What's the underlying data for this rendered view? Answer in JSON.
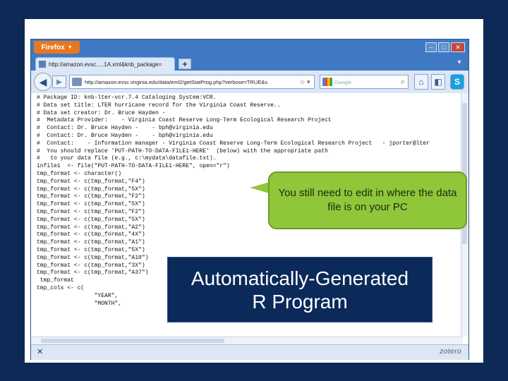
{
  "browser": {
    "app_button": "Firefox",
    "tab_title": "http://amazon.evsc.....1A.xml&knb_package=",
    "new_tab": "+",
    "url": "http://amazon.evsc.virginia.edu/data/eml2/getStatProg.php?verbose=TRUE&s",
    "search_placeholder": "Google",
    "status_right": "zotero"
  },
  "code_lines": [
    "# Package ID: knb-lter-vcr.7.4 Cataloging System:VCR.",
    "# Data set title: LTER hurricane record for the Virginia Coast Reserve..",
    "# Data set creator: Dr. Bruce Hayden -",
    "#  Metadata Provider:    - Virginia Coast Reserve Long-Term Ecological Research Project",
    "#  Contact: Dr. Bruce Hayden -    - bph@virginia.edu",
    "#  Contact: Dr. Bruce Hayden -    - bph@virginia.edu",
    "#  Contact:    - Information manager - Virginia Coast Reserve Long-Term Ecological Research Project   - jporter@lter",
    "#  You should replace 'PUT-PATH-TO-DATA-FILE1-HERE'  (below) with the appropriate path",
    "#   to your data file (e.g., c:\\mydata\\datafile.txt).",
    "infile1  <- file(\"PUT-PATH-TO-DATA-FILE1-HERE\", open=\"r\")",
    "tmp_format <- character()",
    "tmp_format <- c(tmp_format,\"F4\")",
    "tmp_format <- c(tmp_format,\"5X\")",
    "tmp_format <- c(tmp_format,\"F2\")",
    "tmp_format <- c(tmp_format,\"5X\")",
    "tmp_format <- c(tmp_format,\"F2\")",
    "tmp_format <- c(tmp_format,\"5X\")",
    "tmp_format <- c(tmp_format,\"A2\")",
    "tmp_format <- c(tmp_format,\"4X\")",
    "tmp_format <- c(tmp_format,\"A1\")",
    "tmp_format <- c(tmp_format,\"5X\")",
    "tmp_format <- c(tmp_format,\"A10\")",
    "tmp_format <- c(tmp_format,\"3X\")",
    "tmp_format <- c(tmp_format,\"A37\")",
    " tmp_format",
    "tmp_cols <- c(",
    "                 \"YEAR\",",
    "                 \"MONTH\","
  ],
  "callout": {
    "text": "You still need to edit in where the data file is on your PC"
  },
  "caption": {
    "line1": "Automatically-Generated",
    "line2": "R Program"
  },
  "colors": {
    "slide_background": "#0d2a57",
    "callout_fill": "#90c63a",
    "caption_fill": "#0b2a5a",
    "firefox_button": "#e87721"
  },
  "icons": [
    "back-arrow-icon",
    "forward-arrow-icon",
    "page-icon",
    "reload-icon",
    "google-icon",
    "search-icon",
    "home-icon",
    "addon-icon",
    "skype-icon",
    "close-icon"
  ]
}
